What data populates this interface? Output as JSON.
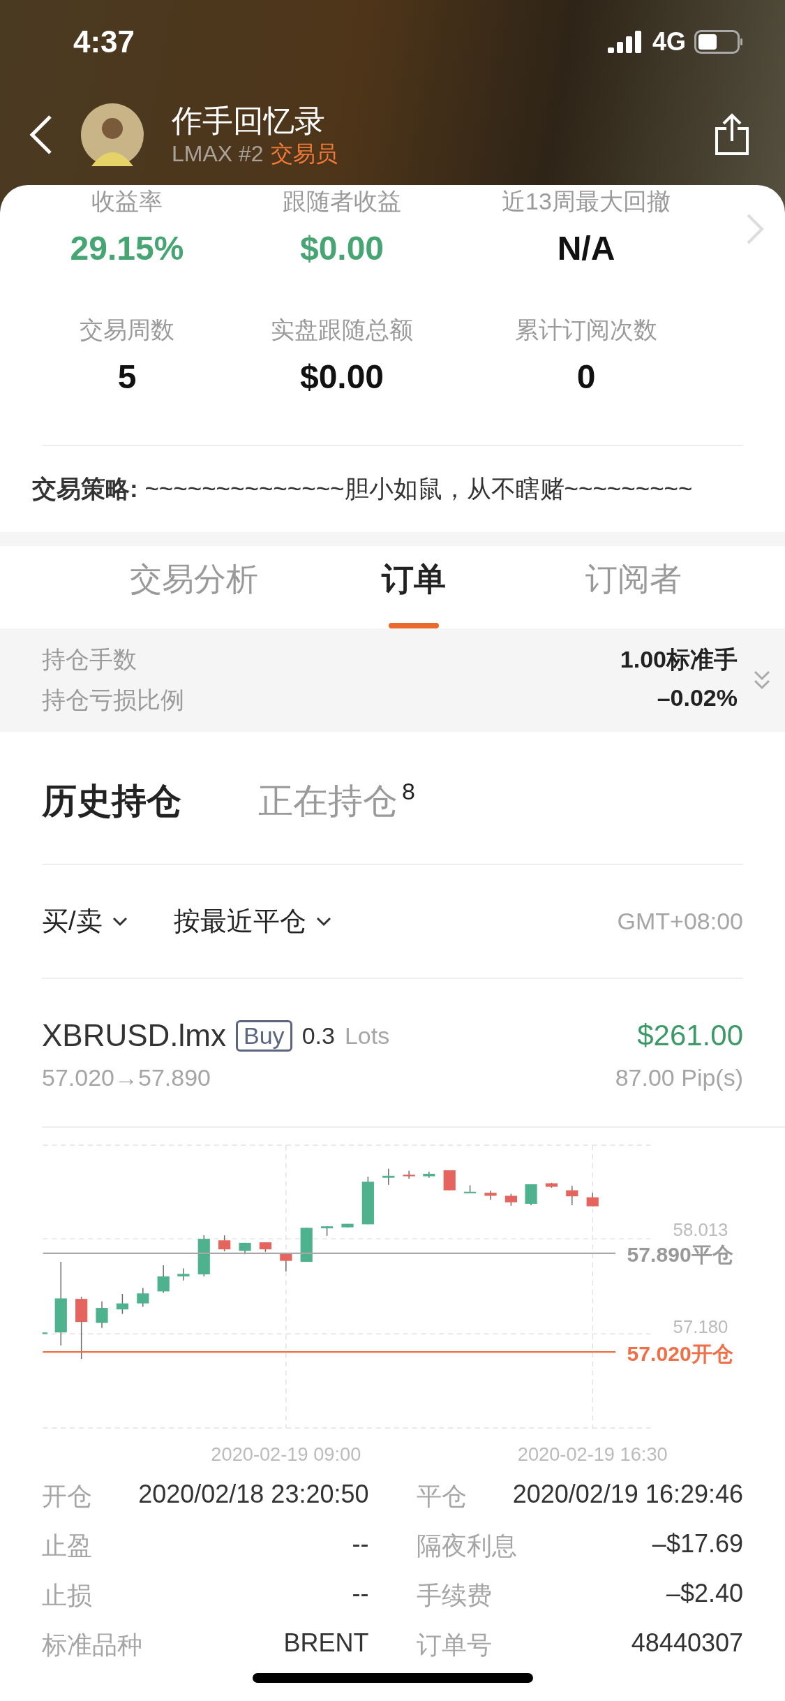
{
  "status_bar": {
    "time": "4:37",
    "network": "4G"
  },
  "header": {
    "title": "作手回忆录",
    "broker": "LMAX #2",
    "role": "交易员"
  },
  "stats": [
    {
      "label": "收益率",
      "value": "29.15%",
      "color": "#46a572"
    },
    {
      "label": "跟随者收益",
      "value": "$0.00",
      "color": "#46a572"
    },
    {
      "label": "近13周最大回撤",
      "value": "N/A",
      "color": "#111111"
    },
    {
      "label": "交易周数",
      "value": "5",
      "color": "#111111"
    },
    {
      "label": "实盘跟随总额",
      "value": "$0.00",
      "color": "#111111"
    },
    {
      "label": "累计订阅次数",
      "value": "0",
      "color": "#111111"
    }
  ],
  "strategy": {
    "label": "交易策略:",
    "text": "~~~~~~~~~~~~~~胆小如鼠，从不瞎赌~~~~~~~~~"
  },
  "tabs": [
    {
      "label": "交易分析",
      "selected": false
    },
    {
      "label": "订单",
      "selected": true
    },
    {
      "label": "订阅者",
      "selected": false
    }
  ],
  "summary": [
    {
      "label": "持仓手数",
      "value": "1.00标准手"
    },
    {
      "label": "持仓亏损比例",
      "value": "–0.02%"
    }
  ],
  "position_tabs": [
    {
      "label": "历史持仓",
      "selected": true
    },
    {
      "label": "正在持仓",
      "count": "8",
      "selected": false
    }
  ],
  "filters": [
    {
      "label": "买/卖"
    },
    {
      "label": "按最近平仓"
    }
  ],
  "timezone": "GMT+08:00",
  "order": {
    "symbol": "XBRUSD.lmx",
    "side": "Buy",
    "lots": "0.3",
    "lots_unit": "Lots",
    "profit": "$261.00",
    "prices": "57.020→57.890",
    "pips": "87.00 Pip(s)"
  },
  "chart": {
    "y_labels": [
      "58.013",
      "57.180"
    ],
    "close_line": "57.890平仓",
    "open_line": "57.020开仓",
    "x_labels": [
      "2020-02-19 09:00",
      "2020-02-19 16:30"
    ]
  },
  "details": [
    {
      "label": "开仓",
      "value": "2020/02/18 23:20:50"
    },
    {
      "label": "平仓",
      "value": "2020/02/19 16:29:46"
    },
    {
      "label": "止盈",
      "value": "--"
    },
    {
      "label": "隔夜利息",
      "value": "–$17.69"
    },
    {
      "label": "止损",
      "value": "--"
    },
    {
      "label": "手续费",
      "value": "–$2.40"
    },
    {
      "label": "标准品种",
      "value": "BRENT"
    },
    {
      "label": "订单号",
      "value": "48440307"
    }
  ]
}
